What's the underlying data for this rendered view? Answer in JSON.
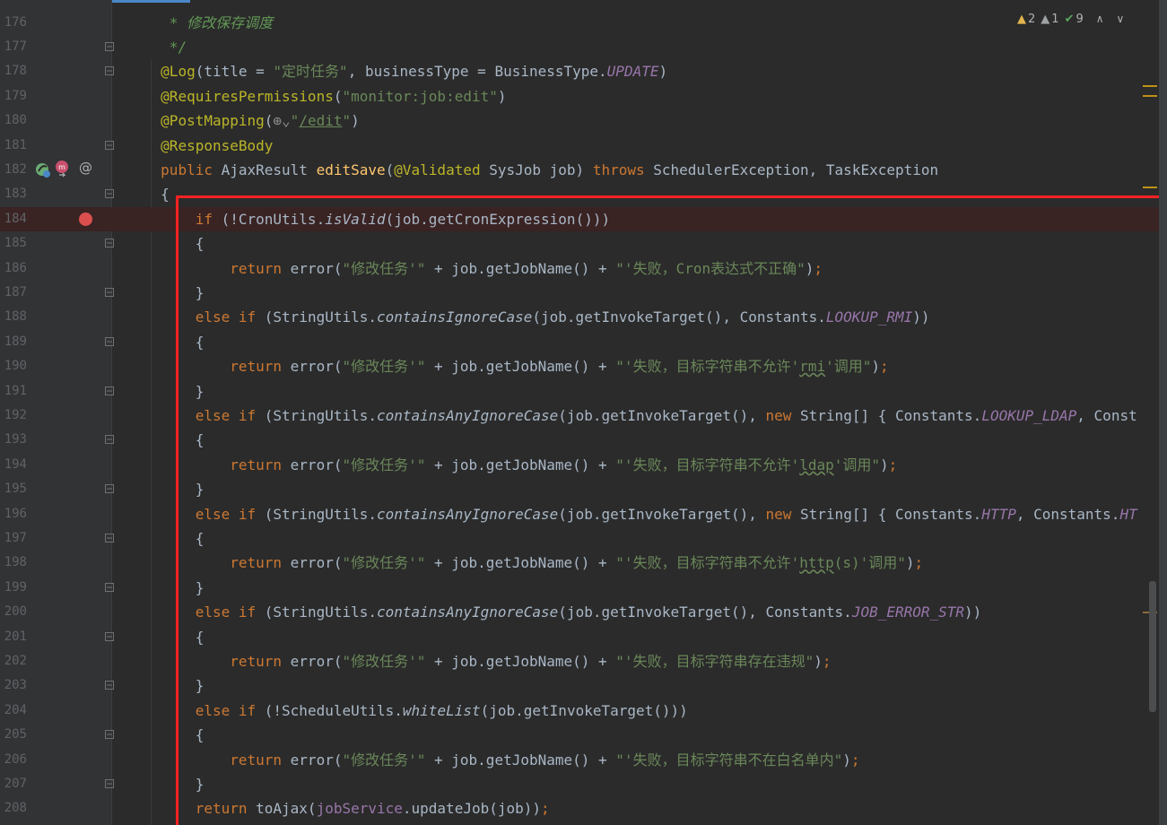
{
  "indicators": {
    "warn_count": "2",
    "weak_warn_count": "1",
    "ok_count": "9"
  },
  "gutter": {
    "at_icon": "@"
  },
  "lines": [
    {
      "n": "176",
      "html": "<span class='cmt'> * 修改保存调度</span>"
    },
    {
      "n": "177",
      "html": "<span class='cmt'> */</span>"
    },
    {
      "n": "178",
      "html": "<span class='ann'>@Log</span>(title = <span class='str'>\"定时任务\"</span>, businessType = BusinessType.<span class='stat'>UPDATE</span>)"
    },
    {
      "n": "179",
      "html": "<span class='ann'>@RequiresPermissions</span>(<span class='str'>\"monitor:job:edit\"</span>)"
    },
    {
      "n": "180",
      "html": "<span class='ann'>@PostMapping</span>(<span style='color:#8c8c8c'>⊕⌄</span><span class='str'>\"<span class='link'>/edit</span>\"</span>)"
    },
    {
      "n": "181",
      "html": "<span class='ann'>@ResponseBody</span>"
    },
    {
      "n": "182",
      "html": "<span class='kw'>public</span> AjaxResult <span class='mth'>editSave</span>(<span class='ann'>@Validated</span> SysJob job) <span class='kw'>throws</span> SchedulerException, TaskException"
    },
    {
      "n": "183",
      "html": "{"
    },
    {
      "n": "184",
      "bp": true,
      "html": "    <span class='kw'>if</span> (!CronUtils.<span class='ital'>isValid</span>(job.getCronExpression()))"
    },
    {
      "n": "185",
      "html": "    {"
    },
    {
      "n": "186",
      "html": "        <span class='kw'>return</span> error(<span class='str'>\"修改任务'\"</span> + job.getJobName() + <span class='str'>\"'失败，Cron表达式不正确\"</span>)<span class='kw'>;</span>"
    },
    {
      "n": "187",
      "html": "    }"
    },
    {
      "n": "188",
      "html": "    <span class='kw'>else if</span> (StringUtils.<span class='ital'>containsIgnoreCase</span>(job.getInvokeTarget(), Constants.<span class='stat'>LOOKUP_RMI</span>))"
    },
    {
      "n": "189",
      "html": "    {"
    },
    {
      "n": "190",
      "html": "        <span class='kw'>return</span> error(<span class='str'>\"修改任务'\"</span> + job.getJobName() + <span class='str'>\"'失败，目标字符串不允许'<span class='typo'>rmi</span>'调用\"</span>)<span class='kw'>;</span>"
    },
    {
      "n": "191",
      "html": "    }"
    },
    {
      "n": "192",
      "html": "    <span class='kw'>else if</span> (StringUtils.<span class='ital'>containsAnyIgnoreCase</span>(job.getInvokeTarget(), <span class='kw'>new</span> String[] { Constants.<span class='stat'>LOOKUP_LDAP</span>, Const"
    },
    {
      "n": "193",
      "html": "    {"
    },
    {
      "n": "194",
      "html": "        <span class='kw'>return</span> error(<span class='str'>\"修改任务'\"</span> + job.getJobName() + <span class='str'>\"'失败，目标字符串不允许'<span class='typo'>ldap</span>'调用\"</span>)<span class='kw'>;</span>"
    },
    {
      "n": "195",
      "html": "    }"
    },
    {
      "n": "196",
      "html": "    <span class='kw'>else if</span> (StringUtils.<span class='ital'>containsAnyIgnoreCase</span>(job.getInvokeTarget(), <span class='kw'>new</span> String[] { Constants.<span class='stat'>HTTP</span>, Constants.<span class='stat'>HT</span>"
    },
    {
      "n": "197",
      "html": "    {"
    },
    {
      "n": "198",
      "html": "        <span class='kw'>return</span> error(<span class='str'>\"修改任务'\"</span> + job.getJobName() + <span class='str'>\"'失败，目标字符串不允许'<span class='typo'>http</span>(s)'调用\"</span>)<span class='kw'>;</span>"
    },
    {
      "n": "199",
      "html": "    }"
    },
    {
      "n": "200",
      "html": "    <span class='kw'>else if</span> (StringUtils.<span class='ital'>containsAnyIgnoreCase</span>(job.getInvokeTarget(), Constants.<span class='stat'>JOB_ERROR_STR</span>))"
    },
    {
      "n": "201",
      "html": "    {"
    },
    {
      "n": "202",
      "html": "        <span class='kw'>return</span> error(<span class='str'>\"修改任务'\"</span> + job.getJobName() + <span class='str'>\"'失败，目标字符串存在违规\"</span>)<span class='kw'>;</span>"
    },
    {
      "n": "203",
      "html": "    }"
    },
    {
      "n": "204",
      "html": "    <span class='kw'>else if</span> (!ScheduleUtils.<span class='ital'>whiteList</span>(job.getInvokeTarget()))"
    },
    {
      "n": "205",
      "html": "    {"
    },
    {
      "n": "206",
      "html": "        <span class='kw'>return</span> error(<span class='str'>\"修改任务'\"</span> + job.getJobName() + <span class='str'>\"'失败，目标字符串不在白名单内\"</span>)<span class='kw'>;</span>"
    },
    {
      "n": "207",
      "html": "    }"
    },
    {
      "n": "208",
      "html": "    <span class='kw'>return</span> toAjax(<span class='fld'>jobService</span>.updateJob(job))<span class='kw'>;</span>"
    }
  ],
  "folds": [
    "177",
    "178",
    "181",
    "183",
    "185",
    "187",
    "189",
    "191",
    "193",
    "195",
    "197",
    "199",
    "201",
    "203",
    "205",
    "207"
  ]
}
